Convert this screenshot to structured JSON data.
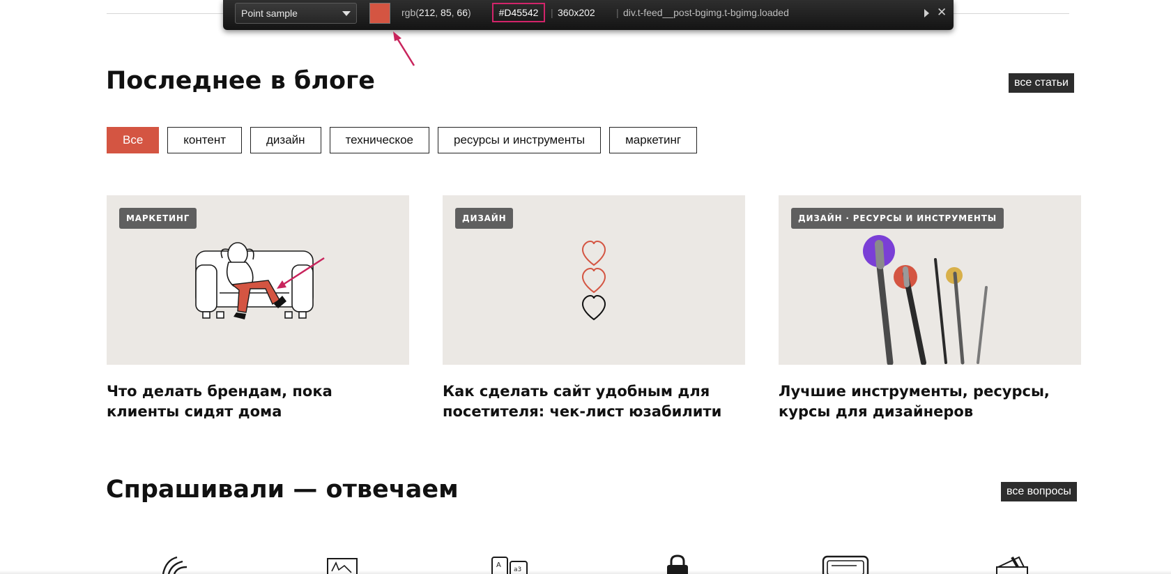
{
  "picker": {
    "mode": "Point sample",
    "swatch_color": "#D45542",
    "rgb_prefix": "rgb(",
    "r": "212",
    "g": "85",
    "b": "66",
    "rgb_suffix": ")",
    "hex": "#D45542",
    "size": "360x202",
    "selector": "div.t-feed__post-bgimg.t-bgimg.loaded"
  },
  "blog": {
    "title": "Последнее в блоге",
    "all_label": "все статьи",
    "filters": [
      "Все",
      "контент",
      "дизайн",
      "техническое",
      "ресурсы и инструменты",
      "маркетинг"
    ],
    "active_filter": "Все",
    "cards": [
      {
        "tag": "маркетинг",
        "title": "Что делать брендам, пока клиенты сидят дома"
      },
      {
        "tag": "дизайн",
        "title": "Как сделать сайт удобным для посетителя: чек-лист юзабилити"
      },
      {
        "tag": "дизайн · ресурсы и инструменты",
        "title": "Лучшие инструменты, ресурсы, курсы для дизайнеров"
      }
    ]
  },
  "faq": {
    "title": "Спрашивали — отвечаем",
    "all_label": "все вопросы"
  },
  "colors": {
    "accent": "#D45542",
    "card_bg": "#EBE8E4",
    "tag_bg": "#5F5F5F",
    "highlight": "#D2246A"
  },
  "icons": [
    "plant-icon",
    "frame-icon",
    "letters-icon",
    "lock-icon",
    "browser-icon",
    "card-icon"
  ]
}
